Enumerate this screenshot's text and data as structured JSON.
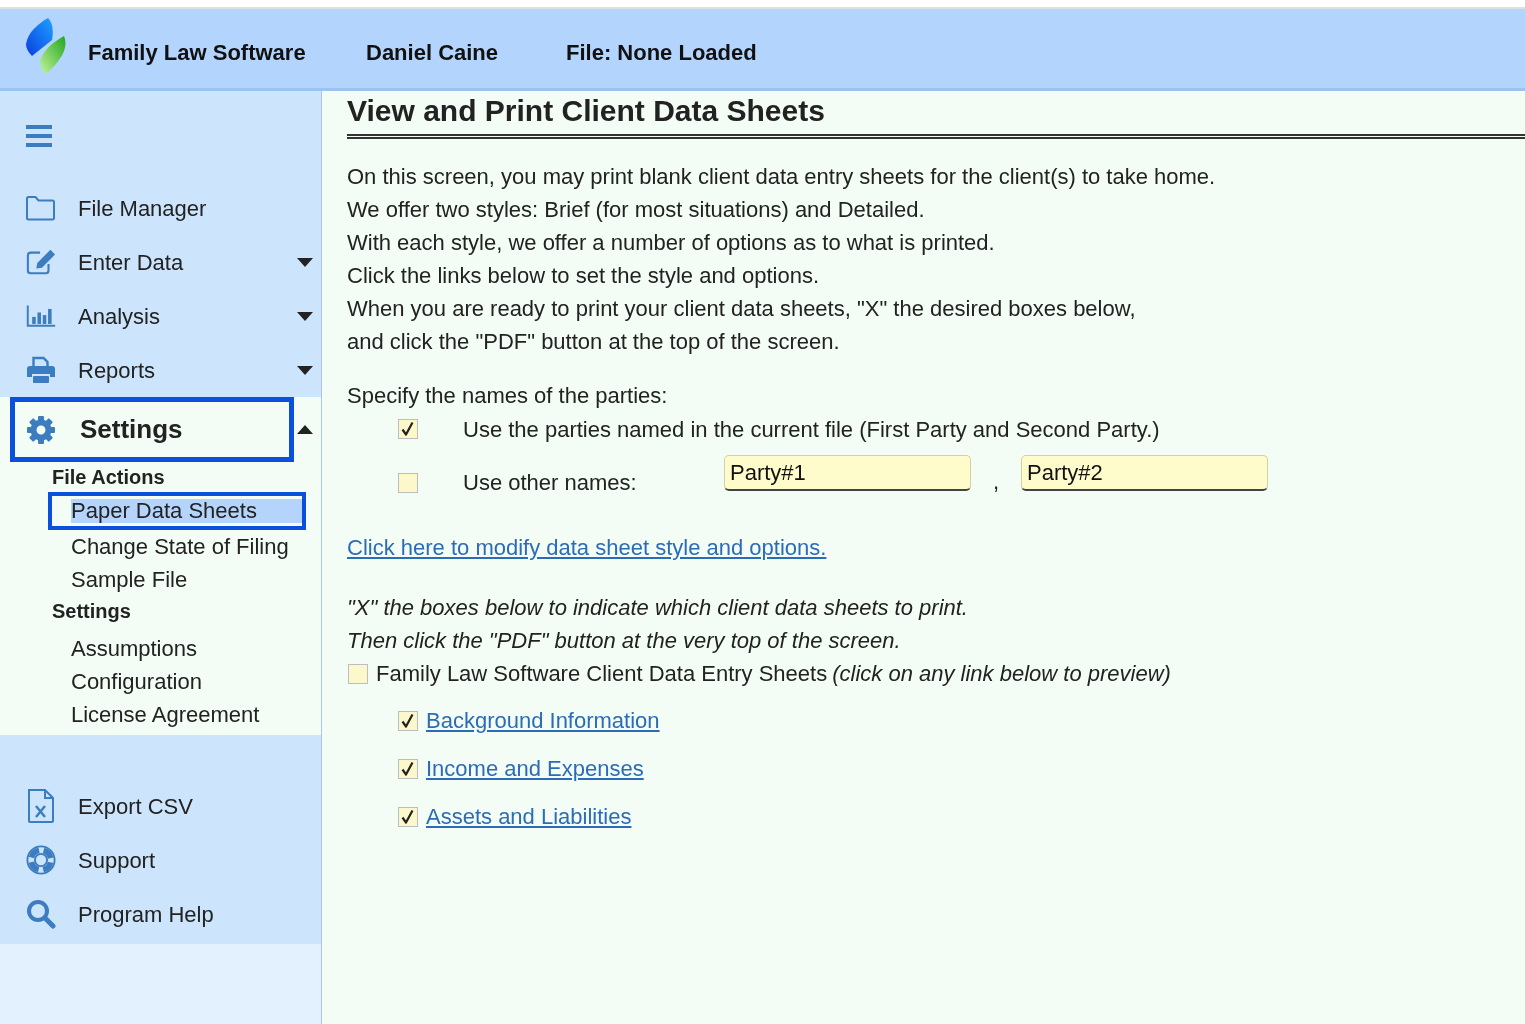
{
  "header": {
    "app_name": "Family Law Software",
    "user_name": "Daniel Caine",
    "file_status": "File: None Loaded"
  },
  "sidebar": {
    "menu": [
      {
        "kind": "link",
        "label": "File Manager",
        "highlighted": false
      },
      {
        "kind": "dropdown",
        "label": "Enter Data",
        "expanded": false,
        "highlighted": false
      },
      {
        "kind": "dropdown",
        "label": "Analysis",
        "expanded": false,
        "highlighted": false
      },
      {
        "kind": "dropdown",
        "label": "Reports",
        "expanded": false,
        "highlighted": false
      },
      {
        "kind": "dropdown",
        "label": "Settings",
        "expanded": true,
        "highlighted": true,
        "children": [
          {
            "heading": "File Actions",
            "items": [
              {
                "label": "Paper Data Sheets",
                "selected": true,
                "highlighted": true
              },
              {
                "label": "Change State of Filing",
                "selected": false,
                "highlighted": false
              },
              {
                "label": "Sample File",
                "selected": false,
                "highlighted": false
              }
            ]
          },
          {
            "heading": "Settings",
            "items": [
              {
                "label": "Assumptions",
                "selected": false,
                "highlighted": false
              },
              {
                "label": "Configuration",
                "selected": false,
                "highlighted": false
              },
              {
                "label": "License Agreement",
                "selected": false,
                "highlighted": false
              }
            ]
          }
        ]
      }
    ],
    "tools": [
      {
        "label": "Export CSV"
      },
      {
        "label": "Support"
      },
      {
        "label": "Program Help"
      }
    ]
  },
  "main": {
    "title": "View and Print Client Data Sheets",
    "intro": [
      "On this screen, you may print blank client data entry sheets for the client(s) to take home.",
      "We offer two styles: Brief (for most situations) and Detailed.",
      "With each style, we offer a number of options as to what is printed.",
      "Click the links below to set the style and options.",
      "When you are ready to print your client data sheets, \"X\" the desired boxes below,",
      "and click the \"PDF\" button at the top of the screen."
    ],
    "parties": {
      "label": "Specify the names of the parties:",
      "options": [
        {
          "kind": "plain",
          "label": "Use the parties named in the current file (First Party and Second Party.)",
          "checked": true
        },
        {
          "kind": "names",
          "label": "Use other names:",
          "checked": false,
          "fields": [
            {
              "value": "Party#1"
            },
            {
              "value": "Party#2"
            }
          ],
          "separator": ","
        }
      ]
    },
    "style_link": "Click here to modify data sheet style and options.",
    "instructions": [
      "\"X\" the boxes below to indicate which client data sheets to print.",
      "Then click the \"PDF\" button at the very top of the screen."
    ],
    "sheets": {
      "label": "Family Law Software Client Data Entry Sheets",
      "note": "(click on any link below to preview)",
      "checked": false,
      "items": [
        {
          "label": "Background Information",
          "checked": true
        },
        {
          "label": "Income and Expenses",
          "checked": true
        },
        {
          "label": "Assets and Liabilities",
          "checked": true
        }
      ]
    }
  }
}
